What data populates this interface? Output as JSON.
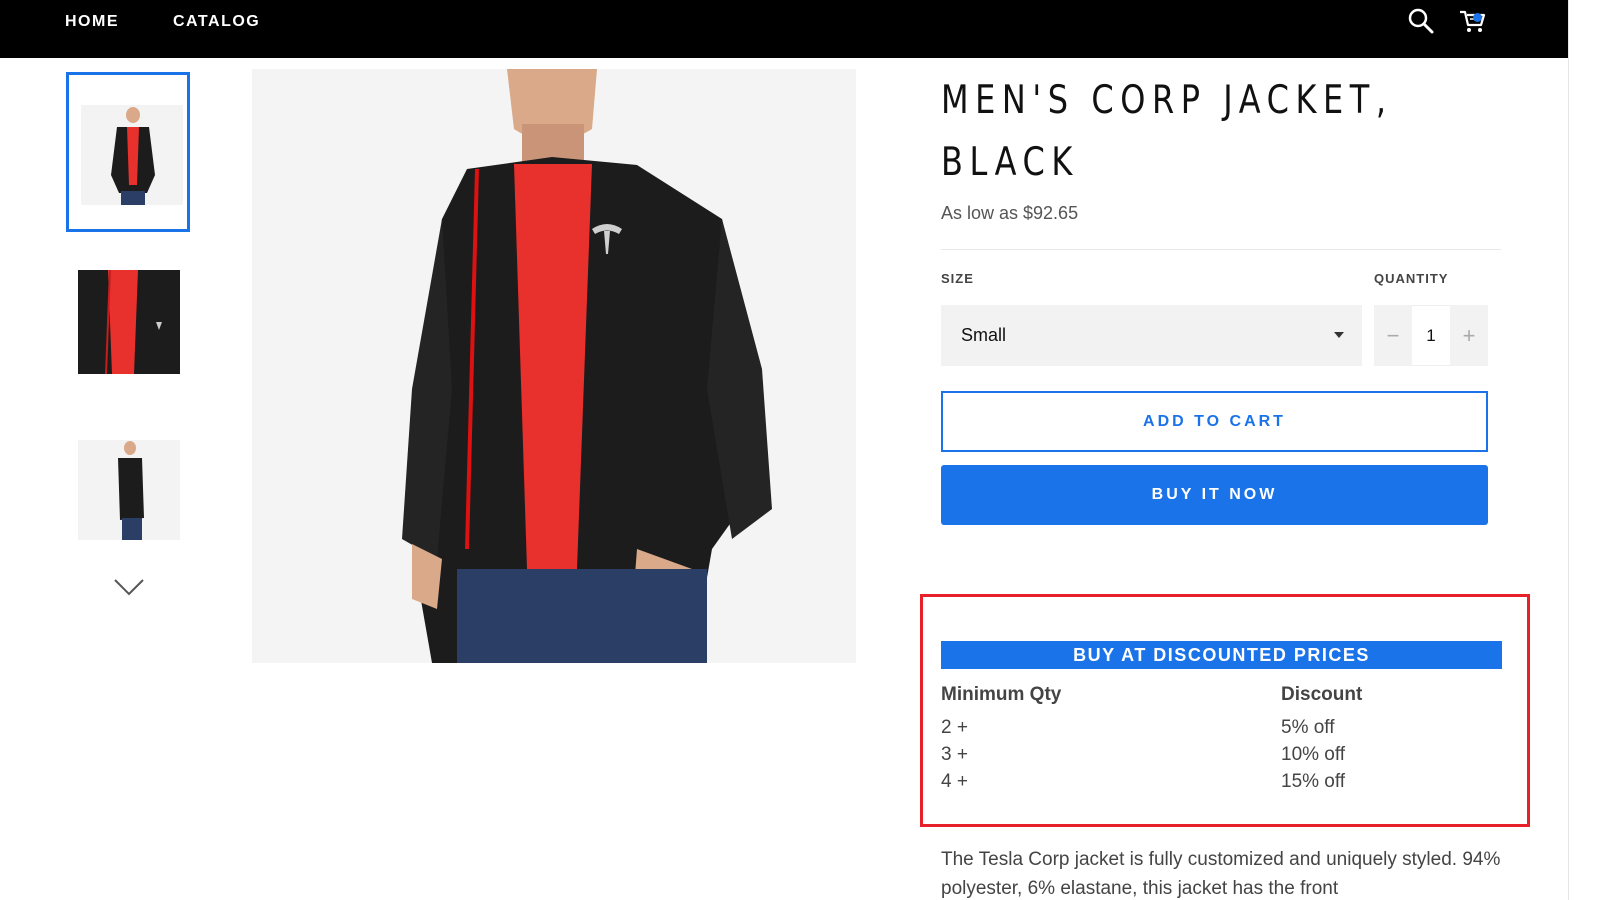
{
  "nav": {
    "home": "HOME",
    "catalog": "CATALOG",
    "search_icon": "search-icon",
    "cart_icon": "cart-icon"
  },
  "product": {
    "title": "MEN'S CORP JACKET, BLACK",
    "price": "As low as $92.65",
    "size_label": "SIZE",
    "size_value": "Small",
    "qty_label": "QUANTITY",
    "qty_value": "1",
    "qty_minus": "−",
    "qty_plus": "+",
    "add_to_cart": "ADD TO CART",
    "buy_now": "BUY IT NOW"
  },
  "discount": {
    "heading": "BUY AT DISCOUNTED PRICES",
    "col_qty": "Minimum Qty",
    "col_discount": "Discount",
    "rows": [
      {
        "qty": "2 +",
        "discount": "5% off"
      },
      {
        "qty": "3 +",
        "discount": "10% off"
      },
      {
        "qty": "4 +",
        "discount": "15% off"
      }
    ]
  },
  "description": "The Tesla Corp jacket is fully customized and uniquely styled. 94% polyester, 6% elastane, this jacket has the front",
  "colors": {
    "accent": "#1a73e8",
    "highlight_border": "#e8202a",
    "jacket": "#1c1c1c",
    "shirt": "#e8312c"
  }
}
